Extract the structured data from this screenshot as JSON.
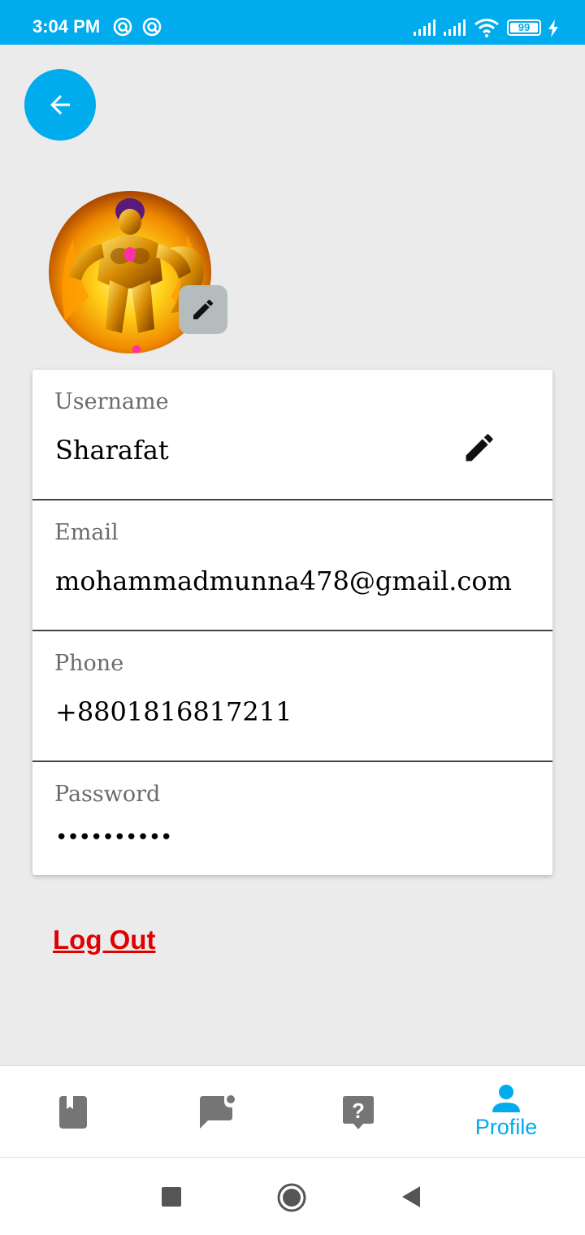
{
  "status_bar": {
    "time": "3:04 PM",
    "battery": "99",
    "icons": [
      "notification-icon",
      "notification-icon",
      "signal-icon",
      "signal-icon",
      "wifi-icon",
      "battery-icon",
      "charging-icon"
    ]
  },
  "colors": {
    "accent": "#00aced",
    "logout": "#e00000",
    "background": "#ebebeb"
  },
  "profile": {
    "fields": [
      {
        "label": "Username",
        "value": "Sharafat"
      },
      {
        "label": "Email",
        "value": "mohammadmunna478@gmail.com"
      },
      {
        "label": "Phone",
        "value": "+8801816817211"
      },
      {
        "label": "Password",
        "value": "••••••••••"
      }
    ],
    "logout_label": "Log Out"
  },
  "bottom_nav": {
    "items": [
      {
        "icon": "book-icon",
        "label": ""
      },
      {
        "icon": "chat-icon",
        "label": ""
      },
      {
        "icon": "help-icon",
        "label": ""
      },
      {
        "icon": "person-icon",
        "label": "Profile"
      }
    ],
    "active": "Profile"
  }
}
